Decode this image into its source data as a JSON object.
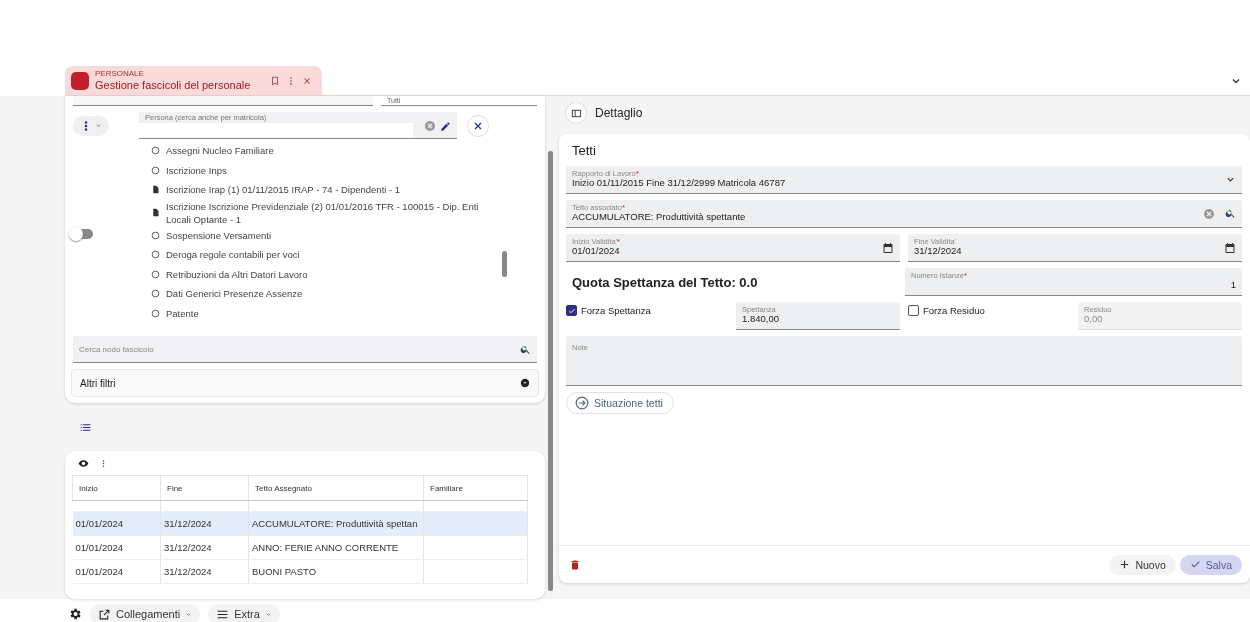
{
  "tab": {
    "category": "PERSONALE",
    "title": "Gestione fascicoli del personale"
  },
  "filters": {
    "top_value": "Tutti",
    "person_label": "Persona (cerca anche per matricola)",
    "toggle_on": false,
    "tree": [
      {
        "kind": "radio",
        "label": "Assegni Nucleo Familiare"
      },
      {
        "kind": "radio",
        "label": "Iscrizione Inps"
      },
      {
        "kind": "doc",
        "label": "Iscrizione Irap (1) 01/11/2015 IRAP - 74 - Dipendenti - 1"
      },
      {
        "kind": "doc",
        "label": "Iscrizione Iscrizione Previdenziale (2) 01/01/2016 TFR - 100015 - Dip. Enti Locali Optante - 1"
      },
      {
        "kind": "radio",
        "label": "Sospensione Versamenti"
      },
      {
        "kind": "radio",
        "label": "Deroga regole contabili per voci"
      },
      {
        "kind": "radio",
        "label": "Retribuzioni da Altri Datori Lavoro"
      },
      {
        "kind": "radio",
        "label": "Dati Generici Presenze Assenze"
      },
      {
        "kind": "radio",
        "label": "Patente"
      }
    ],
    "search_placeholder": "Cerca nodo fascicolo",
    "more_filters": "Altri filtri"
  },
  "table": {
    "columns": [
      "Inizio",
      "Fine",
      "Tetto Assegnato",
      "Familiare"
    ],
    "rows": [
      {
        "selected": true,
        "cells": [
          "01/01/2024",
          "31/12/2024",
          "ACCUMULATORE: Produttività spettan",
          ""
        ]
      },
      {
        "selected": false,
        "cells": [
          "01/01/2024",
          "31/12/2024",
          "ANNO: FERIE ANNO CORRENTE",
          ""
        ]
      },
      {
        "selected": false,
        "cells": [
          "01/01/2024",
          "31/12/2024",
          "BUONI PASTO",
          ""
        ]
      }
    ]
  },
  "bottom_toolbar": {
    "buttons": [
      "Collegamenti",
      "Extra"
    ]
  },
  "detail": {
    "header": "Dettaglio",
    "title": "Tetti",
    "rapporto": {
      "label": "Rapporto di Lavoro",
      "required_mark": "*",
      "value": "Inizio 01/11/2015 Fine 31/12/2999 Matricola 46787"
    },
    "tetto": {
      "label": "Tetto associato",
      "required_mark": "*",
      "value": "ACCUMULATORE: Produttività spettante"
    },
    "inizio": {
      "label": "Inizio Validita'",
      "required_mark": "*",
      "value": "01/01/2024"
    },
    "fine": {
      "label": "Fine Validita'",
      "value": "31/12/2024"
    },
    "quota": "Quota Spettanza del Tetto: 0.0",
    "istanze": {
      "label": "Numero Istanze",
      "required_mark": "*",
      "value": "1"
    },
    "forza_spettanza": {
      "label": "Forza Spettanza",
      "checked": true
    },
    "spettanza": {
      "label": "Spettanza",
      "value": "1.840,00",
      "disabled": false
    },
    "forza_residuo": {
      "label": "Forza Residuo",
      "checked": false
    },
    "residuo": {
      "label": "Residuo",
      "value": "0,00",
      "disabled": true
    },
    "note": {
      "label": "Note"
    },
    "situazione": "Situazione tetti",
    "nuovo": "Nuovo",
    "salva": {
      "label": "Salva",
      "disabled": true
    }
  }
}
